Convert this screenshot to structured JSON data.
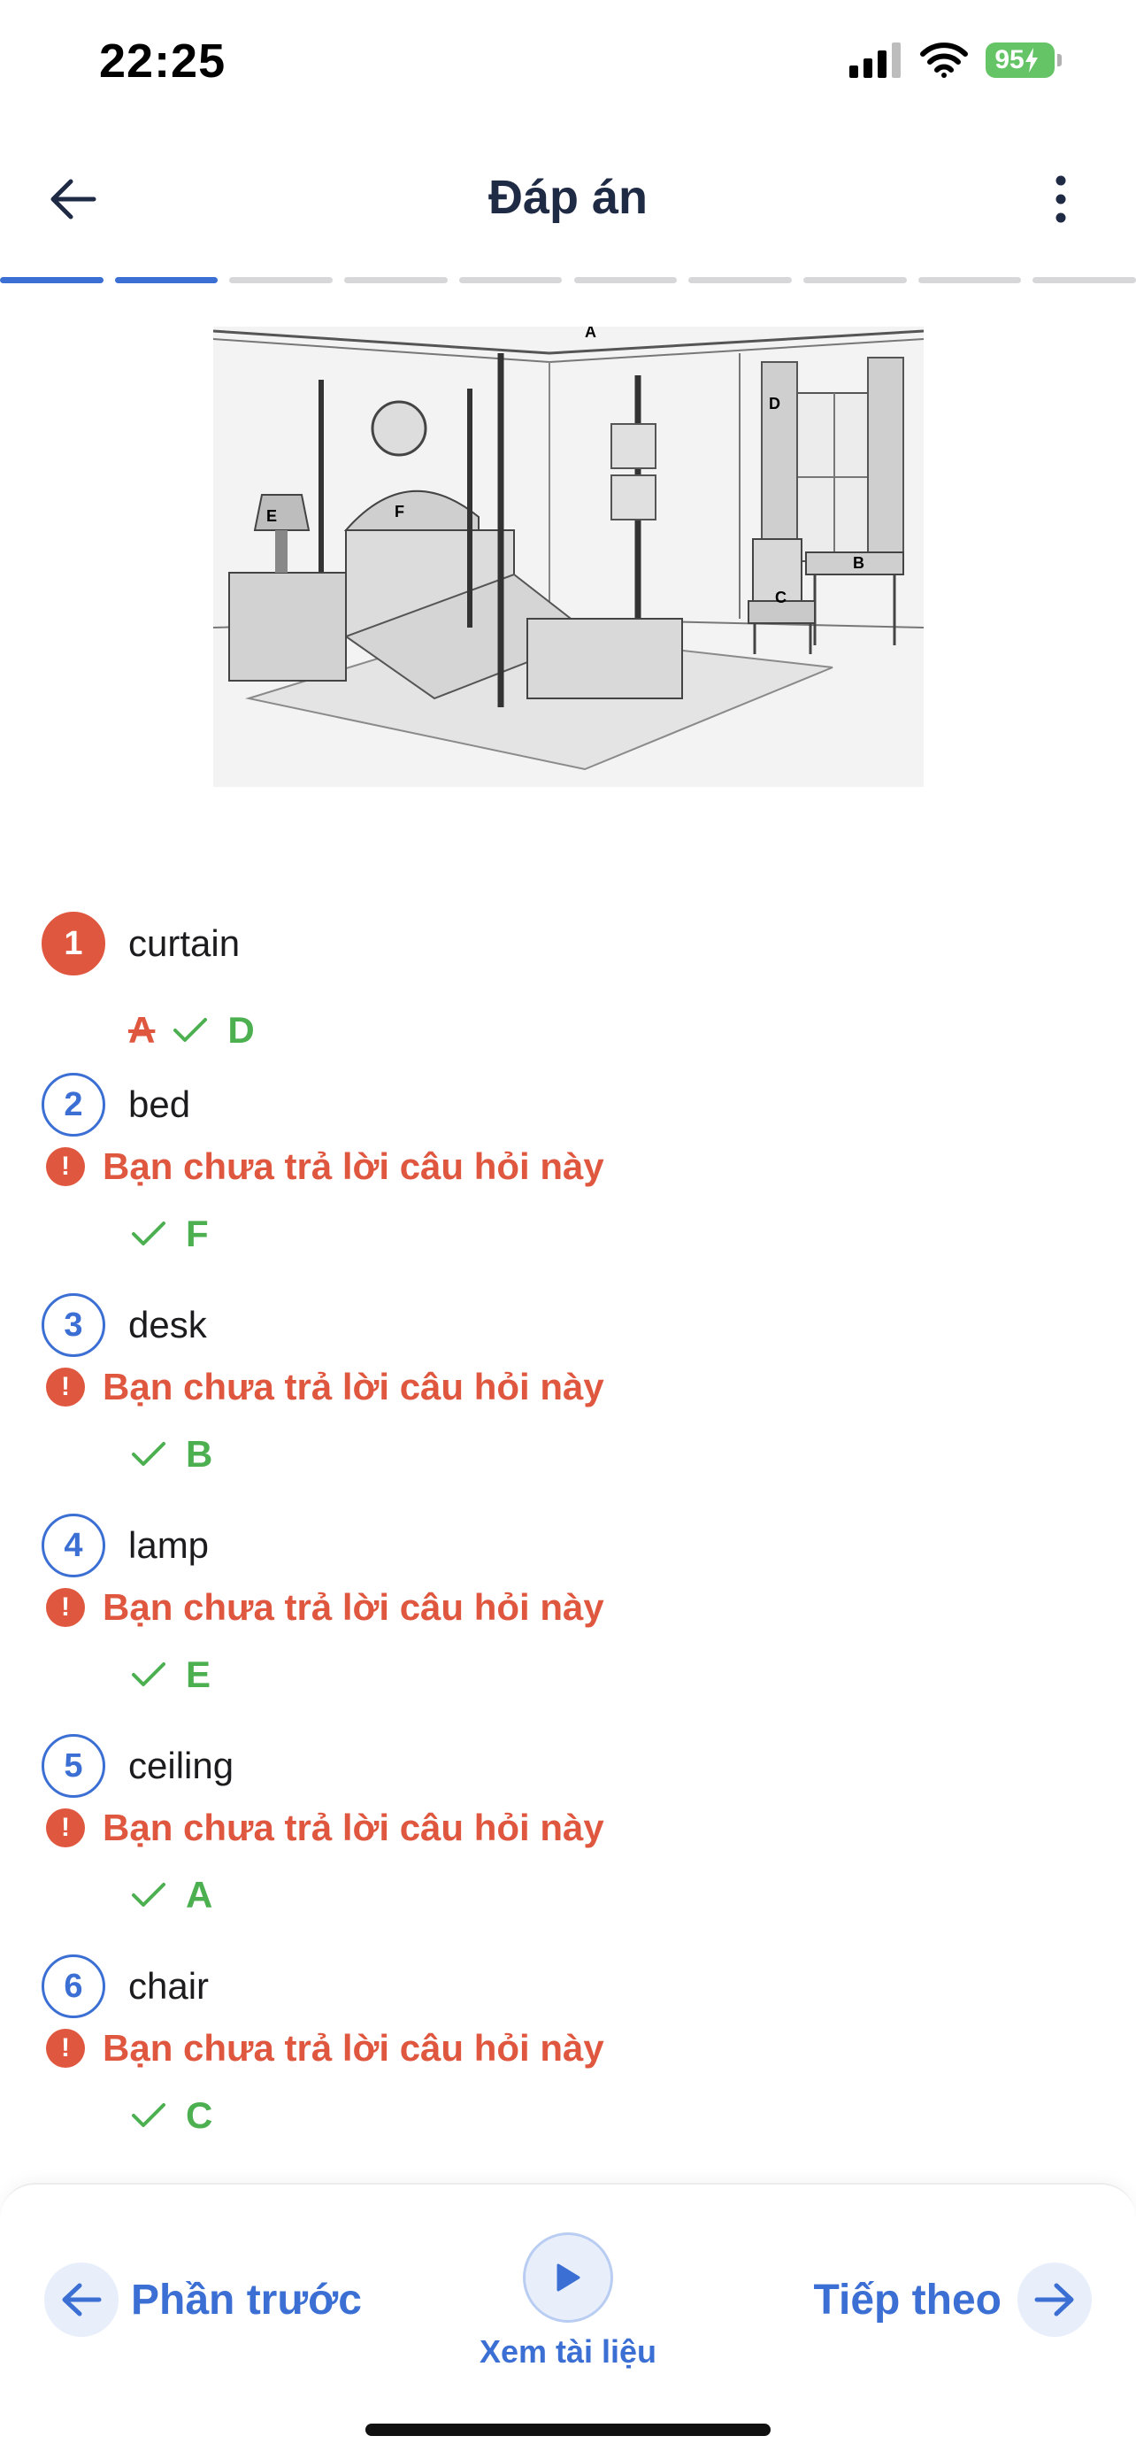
{
  "status_bar": {
    "time": "22:25",
    "battery": "95"
  },
  "header": {
    "title": "Đáp án",
    "back_icon": "arrow-left-icon",
    "more_icon": "more-vertical-icon"
  },
  "progress": {
    "total_segments": 10,
    "completed_segments": 2,
    "accent": "#3b6fd4"
  },
  "illustration": {
    "description_icon": "bedroom-sketch-image",
    "labels": [
      "A",
      "B",
      "C",
      "D",
      "E",
      "F"
    ]
  },
  "questions": [
    {
      "number": "1",
      "word": "curtain",
      "status": "wrong",
      "given": "A",
      "correct": "D"
    },
    {
      "number": "2",
      "word": "bed",
      "status": "unanswered",
      "warning": "Bạn chưa trả lời câu hỏi này",
      "correct": "F"
    },
    {
      "number": "3",
      "word": "desk",
      "status": "unanswered",
      "warning": "Bạn chưa trả lời câu hỏi này",
      "correct": "B"
    },
    {
      "number": "4",
      "word": "lamp",
      "status": "unanswered",
      "warning": "Bạn chưa trả lời câu hỏi này",
      "correct": "E"
    },
    {
      "number": "5",
      "word": "ceiling",
      "status": "unanswered",
      "warning": "Bạn chưa trả lời câu hỏi này",
      "correct": "A"
    },
    {
      "number": "6",
      "word": "chair",
      "status": "unanswered",
      "warning": "Bạn chưa trả lời câu hỏi này",
      "correct": "C"
    }
  ],
  "bottom_bar": {
    "prev_label": "Phần trước",
    "doc_label": "Xem tài liệu",
    "next_label": "Tiếp theo"
  },
  "colors": {
    "accent": "#3b6fd4",
    "error": "#e0573f",
    "success": "#4caf50",
    "title": "#1f2a44"
  }
}
